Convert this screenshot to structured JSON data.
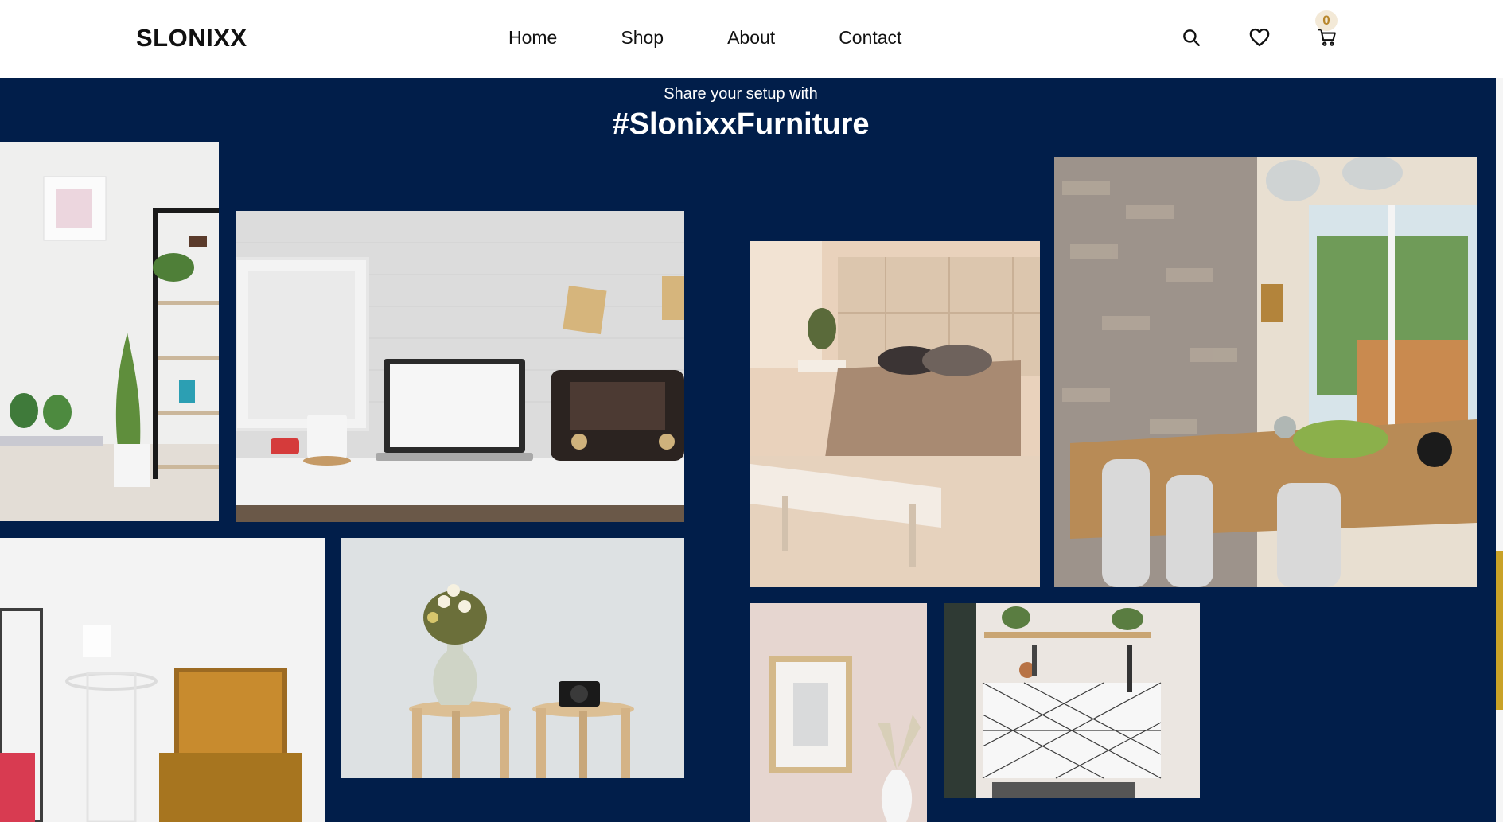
{
  "brand": {
    "logo": "SLONIXX"
  },
  "nav": {
    "links": [
      "Home",
      "Shop",
      "About",
      "Contact"
    ],
    "icons": [
      "search-icon",
      "heart-icon",
      "cart-icon"
    ],
    "cart_count": "0"
  },
  "gallery": {
    "subtitle": "Share your setup with",
    "hashtag": "#SlonixxFurniture",
    "photos": [
      "living-room-shelf-photo",
      "desk-laptop-radio-photo",
      "bedroom-bench-photo",
      "dining-brick-wall-photo",
      "bedroom-armchair-photo",
      "stools-vase-camera-photo",
      "frame-vase-photo",
      "kitchen-shelf-tiles-photo"
    ]
  },
  "colors": {
    "gallery_bg": "#011e4a",
    "badge_bg": "#f3e9d7",
    "badge_text": "#b8862b",
    "accent": "#c9a227"
  }
}
